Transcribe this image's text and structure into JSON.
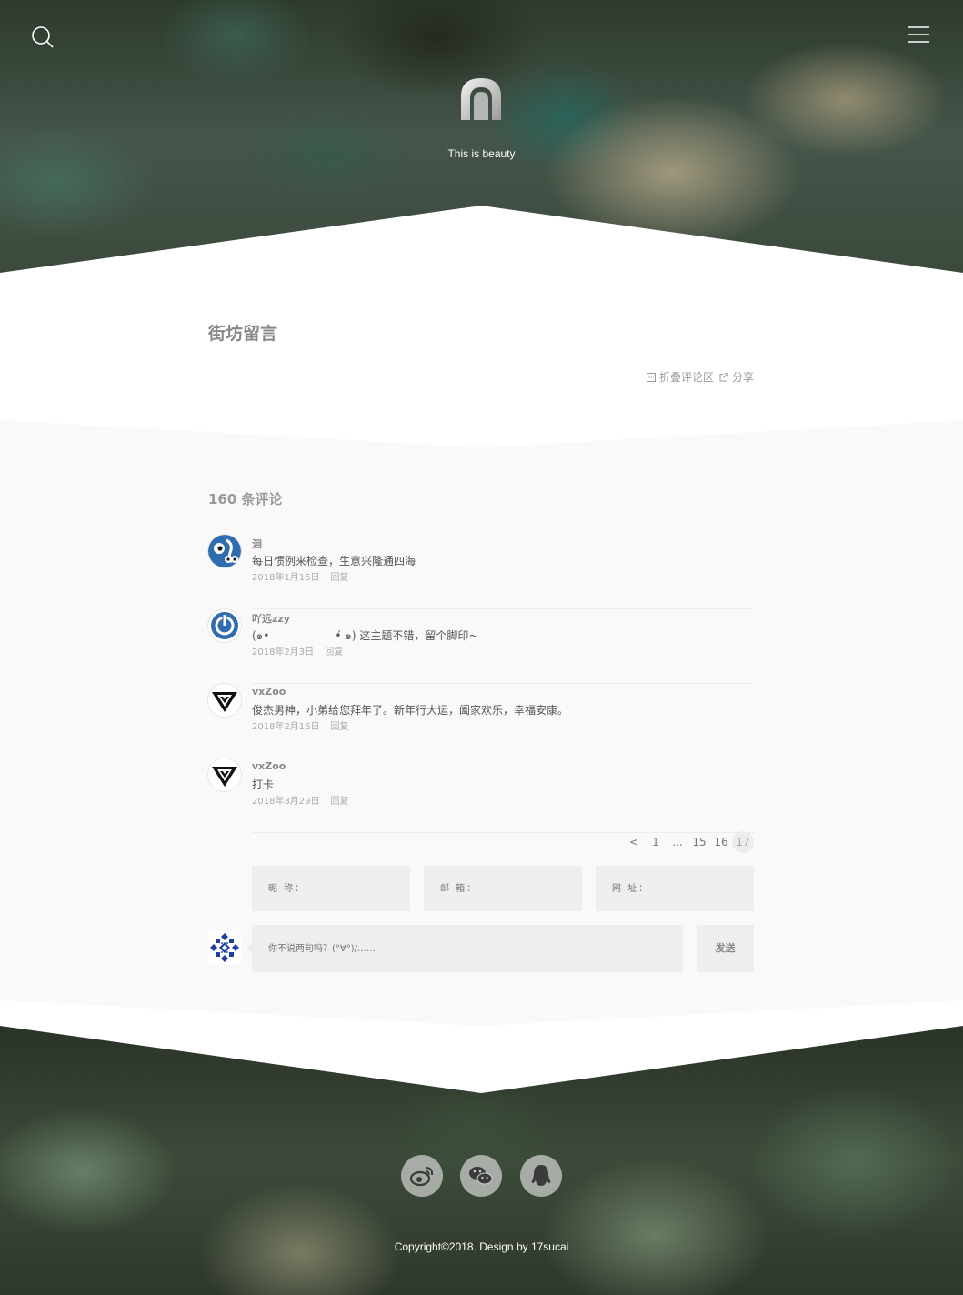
{
  "header": {
    "tagline": "This is beauty"
  },
  "article": {
    "title": "街坊留言",
    "actions": {
      "collapse_label": "折叠评论区",
      "share_label": "分享"
    }
  },
  "comments": {
    "count_label": "160 条评论",
    "items": [
      {
        "name": "洄",
        "text": "每日惯例来检查，生意兴隆通四海",
        "date": "2018年1月16日",
        "reply": "回复",
        "avatar_icon": "cartoon-avatar-icon"
      },
      {
        "name": "吖远zzy",
        "text": "(๑•　　　　　　•́ ๑) 这主题不错，留个脚印~",
        "date": "2018年2月3日",
        "reply": "回复",
        "avatar_icon": "power-ring-avatar-icon"
      },
      {
        "name": "vxZoo",
        "text": "俊杰男神，小弟给您拜年了。新年行大运，阖家欢乐，幸福安康。",
        "date": "2018年2月16日",
        "reply": "回复",
        "avatar_icon": "triangle-logo-avatar-icon"
      },
      {
        "name": "vxZoo",
        "text": "打卡",
        "date": "2018年3月29日",
        "reply": "回复",
        "avatar_icon": "triangle-logo-avatar-icon"
      }
    ],
    "pagination": {
      "prev": "<",
      "pages": [
        "1",
        "...",
        "15",
        "16",
        "17"
      ],
      "current": "17"
    },
    "form": {
      "nickname_label": "昵 称：",
      "email_label": "邮 箱：",
      "website_label": "网 址：",
      "message_placeholder": "你不说两句吗？(°∀°)/……",
      "send_label": "发送"
    }
  },
  "footer": {
    "social_icons": [
      "weibo-icon",
      "wechat-icon",
      "qq-icon"
    ],
    "copyright": "Copyright©2018. Design by 17sucai"
  },
  "colors": {
    "page_bg": "#ffffff",
    "comments_bg": "#f9f9f9",
    "field_bg": "#eeeeee",
    "accent_blue": "#2f6db0"
  }
}
